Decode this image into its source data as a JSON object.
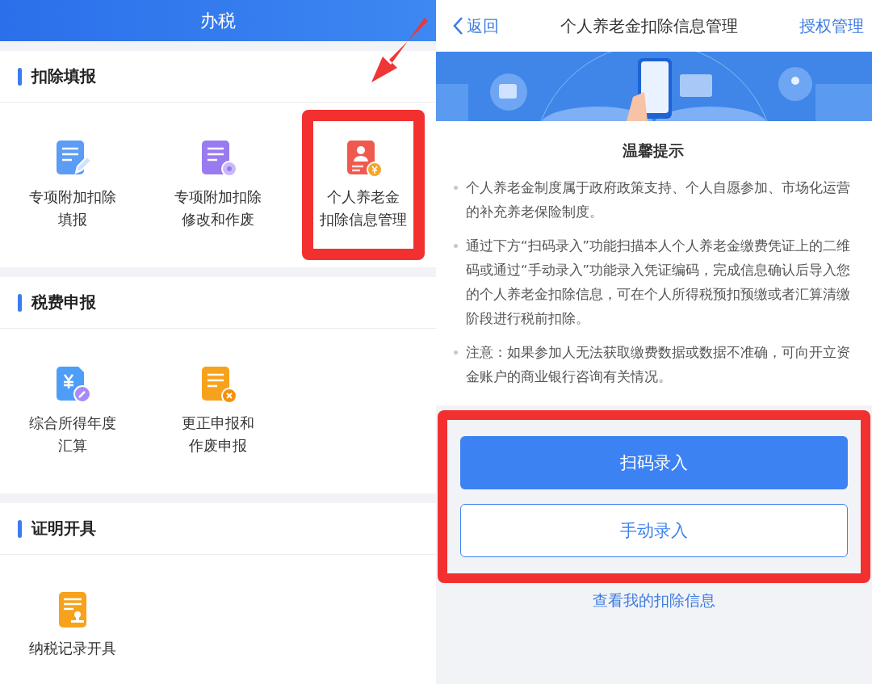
{
  "left_screen": {
    "header": {
      "title": "办税"
    },
    "sections": [
      {
        "title": "扣除填报",
        "items": [
          {
            "label_lines": [
              "专项附加扣除",
              "填报"
            ],
            "highlighted": false
          },
          {
            "label_lines": [
              "专项附加扣除",
              "修改和作废"
            ],
            "highlighted": false
          },
          {
            "label_lines": [
              "个人养老金",
              "扣除信息管理"
            ],
            "highlighted": true
          }
        ]
      },
      {
        "title": "税费申报",
        "items": [
          {
            "label_lines": [
              "综合所得年度",
              "汇算"
            ],
            "highlighted": false
          },
          {
            "label_lines": [
              "更正申报和",
              "作废申报"
            ],
            "highlighted": false
          }
        ]
      },
      {
        "title": "证明开具",
        "items": [
          {
            "label_lines": [
              "纳税记录开具"
            ],
            "highlighted": false
          }
        ]
      }
    ]
  },
  "right_screen": {
    "nav": {
      "back": "返回",
      "title": "个人养老金扣除信息管理",
      "action": "授权管理"
    },
    "notice": {
      "title": "温馨提示",
      "paragraphs": [
        "个人养老金制度属于政府政策支持、个人自愿参加、市场化运营的补充养老保险制度。",
        "通过下方“扫码录入”功能扫描本人个人养老金缴费凭证上的二维码或通过“手动录入”功能录入凭证编码，完成信息确认后导入您的个人养老金扣除信息，可在个人所得税预扣预缴或者汇算清缴阶段进行税前扣除。",
        "注意：如果参加人无法获取缴费数据或数据不准确，可向开立资金账户的商业银行咨询有关情况。"
      ]
    },
    "actions": {
      "highlighted": true,
      "buttons": [
        {
          "label": "扫码录入",
          "kind": "primary"
        },
        {
          "label": "手动录入",
          "kind": "secondary"
        }
      ]
    },
    "link": "查看我的扣除信息"
  }
}
